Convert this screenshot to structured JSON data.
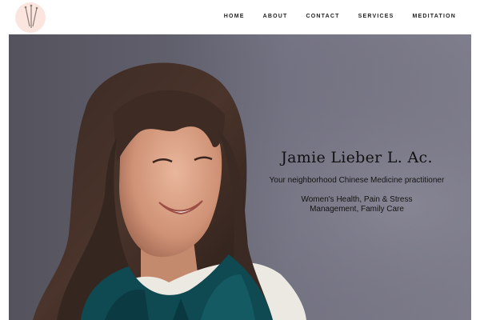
{
  "header": {
    "logo_icon": "acupuncture-needles-logo",
    "nav": [
      {
        "label": "HOME"
      },
      {
        "label": "ABOUT"
      },
      {
        "label": "CONTACT"
      },
      {
        "label": "SERVICES"
      },
      {
        "label": "MEDITATION"
      }
    ]
  },
  "hero": {
    "title": "Jamie Lieber L. Ac.",
    "subtitle": "Your neighborhood Chinese Medicine practitioner",
    "description": "Women's Health, Pain & Stress Management, Family Care"
  },
  "colors": {
    "logo_bg": "#fbe6df",
    "hero_bg": "#6e6d7b",
    "scarf": "#0f4a52"
  }
}
